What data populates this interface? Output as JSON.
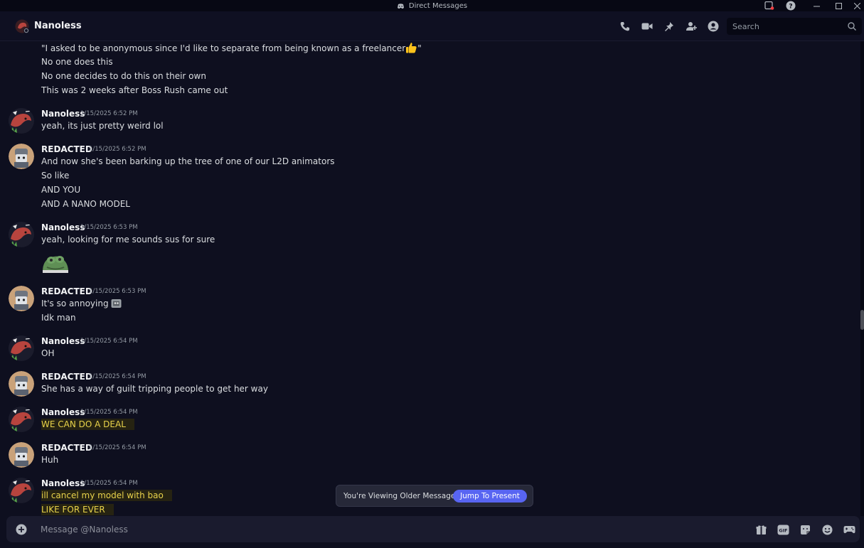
{
  "window": {
    "title": "Direct Messages"
  },
  "header": {
    "name": "Nanoless"
  },
  "search": {
    "placeholder": "Search"
  },
  "messages": {
    "continued": [
      "\"I asked to be anonymous since I'd like to separate from being known as a freelancer",
      "No one does this",
      "No one decides to do this on their own",
      "This was 2 weeks after Boss Rush came out"
    ],
    "continued_end_quote": "\"",
    "groups": [
      {
        "author": "Nanoless",
        "time": "1/15/2025 6:52 PM",
        "lines": [
          "yeah, its just pretty weird lol"
        ]
      },
      {
        "author": "REDACTED",
        "time": "1/15/2025 6:52 PM",
        "lines": [
          "And now she's been barking up the tree of one of our L2D animators",
          "So like",
          "AND YOU",
          "AND A NANO MODEL"
        ]
      },
      {
        "author": "Nanoless",
        "time": "1/15/2025 6:53 PM",
        "lines": [
          "yeah, looking for me sounds sus for sure"
        ]
      },
      {
        "author": "REDACTED",
        "time": "1/15/2025 6:53 PM",
        "lines": [
          "It's so annoying",
          "Idk man"
        ]
      },
      {
        "author": "Nanoless",
        "time": "1/15/2025 6:54 PM",
        "lines": [
          "OH"
        ]
      },
      {
        "author": "REDACTED",
        "time": "1/15/2025 6:54 PM",
        "lines": [
          "She has a way of guilt tripping people to get her way"
        ]
      },
      {
        "author": "Nanoless",
        "time": "1/15/2025 6:54 PM",
        "lines": [
          "WE CAN DO A DEAL"
        ]
      },
      {
        "author": "REDACTED",
        "time": "1/15/2025 6:54 PM",
        "lines": [
          "Huh"
        ]
      },
      {
        "author": "Nanoless",
        "time": "1/15/2025 6:54 PM",
        "lines": [
          "ill cancel my model with bao",
          "LIKE FOR EVER"
        ]
      }
    ]
  },
  "older_bar": {
    "text": "You're Viewing Older Messages",
    "button": "Jump To Present"
  },
  "composer": {
    "placeholder": "Message @Nanoless"
  },
  "colors": {
    "background": "#0e0f1f",
    "accent": "#5865f2",
    "highlight_text": "#e8d24a"
  }
}
